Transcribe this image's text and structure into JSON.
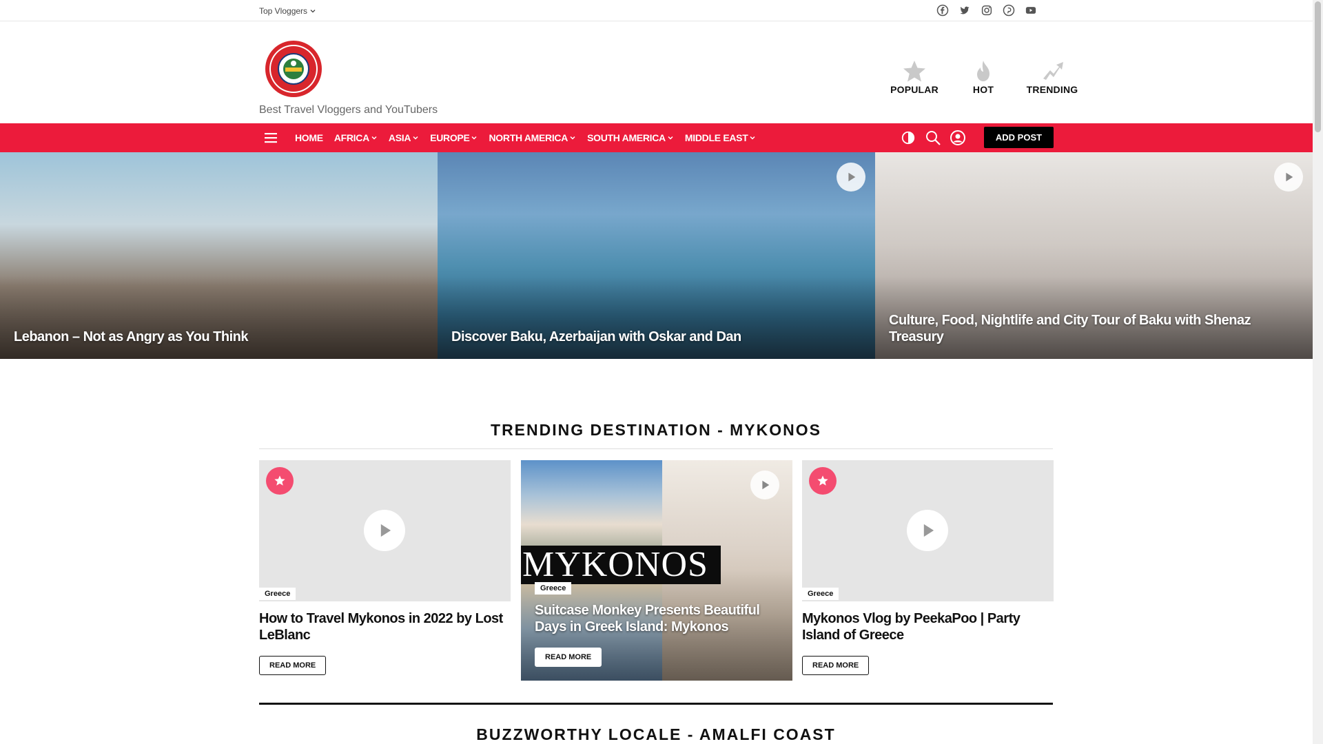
{
  "topbar": {
    "vloggers_label": "Top Vloggers",
    "social": [
      "facebook-icon",
      "twitter-icon",
      "instagram-icon",
      "pinterest-icon",
      "youtube-icon"
    ]
  },
  "header": {
    "tagline": "Best Travel Vloggers and YouTubers",
    "quicknav": [
      {
        "label": "POPULAR",
        "icon": "star-icon"
      },
      {
        "label": "HOT",
        "icon": "flame-icon"
      },
      {
        "label": "TRENDING",
        "icon": "trending-arrow-icon"
      }
    ]
  },
  "nav": {
    "items": [
      {
        "label": "HOME",
        "dropdown": false
      },
      {
        "label": "AFRICA",
        "dropdown": true
      },
      {
        "label": "ASIA",
        "dropdown": true
      },
      {
        "label": "EUROPE",
        "dropdown": true
      },
      {
        "label": "NORTH AMERICA",
        "dropdown": true
      },
      {
        "label": "SOUTH AMERICA",
        "dropdown": true
      },
      {
        "label": "MIDDLE EAST",
        "dropdown": true
      }
    ],
    "add_post": "ADD POST",
    "accent": "#ec1b3b"
  },
  "hero": [
    {
      "caption": "Lebanon – Not as Angry as You Think",
      "has_play": false
    },
    {
      "caption": "Discover Baku, Azerbaijan with Oskar and Dan",
      "has_play": true
    },
    {
      "caption": "Culture, Food, Nightlife and City Tour of Baku with Shenaz Treasury",
      "has_play": true
    }
  ],
  "section1": {
    "title": "TRENDING DESTINATION - MYKONOS",
    "cards": [
      {
        "badge": "Greece",
        "title": "How to Travel Mykonos in 2022 by Lost LeBlanc",
        "read_more": "READ MORE"
      },
      {
        "badge": "Greece",
        "title": "Suitcase Monkey Presents Beautiful Days in Greek Island: Mykonos",
        "read_more": "READ MORE",
        "image_text": "MYKONOS"
      },
      {
        "badge": "Greece",
        "title": "Mykonos Vlog by PeekaPoo | Party Island of Greece",
        "read_more": "READ MORE"
      }
    ]
  },
  "section2": {
    "title": "BUZZWORTHY LOCALE - AMALFI COAST"
  },
  "colors": {
    "star_badge": "#f44c70"
  }
}
